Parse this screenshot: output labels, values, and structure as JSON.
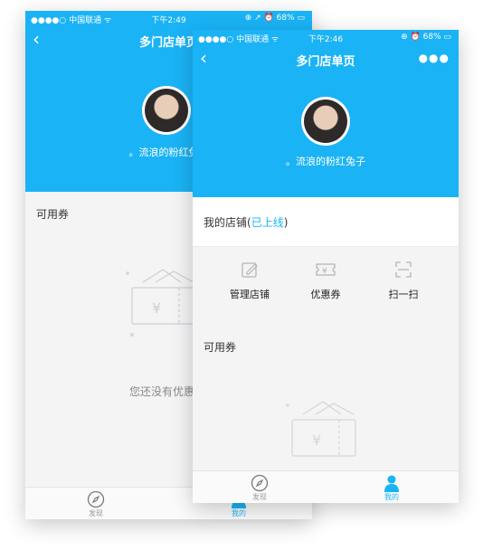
{
  "back_screen": {
    "status": {
      "carrier": "●●●●○ 中国联通 ᯤ",
      "time": "下午2:49",
      "battery": "⊕ ↗ ⏰ 68% ▭"
    },
    "nav": {
      "back_icon": "chevron-left-icon",
      "title": "多门店单页"
    },
    "profile": {
      "name": "。流浪的粉红兔子"
    },
    "section_label": "可用券",
    "empty_text": "您还没有优惠券",
    "tabs": [
      {
        "label": "发现",
        "icon": "compass-icon",
        "active": false
      },
      {
        "label": "我的",
        "icon": "user-icon",
        "active": true
      }
    ]
  },
  "front_screen": {
    "status": {
      "carrier": "●●●●○ 中国联通 ᯤ",
      "time": "下午2:46",
      "battery": "⊕ ⏰ 68% ▭"
    },
    "nav": {
      "back_icon": "chevron-left-icon",
      "title": "多门店单页",
      "more_icon": "more-icon"
    },
    "profile": {
      "name": "。流浪的粉红兔子"
    },
    "store": {
      "prefix": "我的店铺(",
      "status": "已上线",
      "suffix": ")"
    },
    "actions": [
      {
        "label": "管理店铺",
        "icon": "edit-icon"
      },
      {
        "label": "优惠券",
        "icon": "coupon-icon"
      },
      {
        "label": "扫一扫",
        "icon": "scan-icon"
      }
    ],
    "section_label": "可用券",
    "tabs": [
      {
        "label": "发现",
        "icon": "compass-icon",
        "active": false
      },
      {
        "label": "我的",
        "icon": "user-icon",
        "active": true
      }
    ]
  },
  "colors": {
    "accent": "#1ab3f5",
    "background": "#f4f4f5",
    "inactive_tab": "#9a9a9a"
  }
}
